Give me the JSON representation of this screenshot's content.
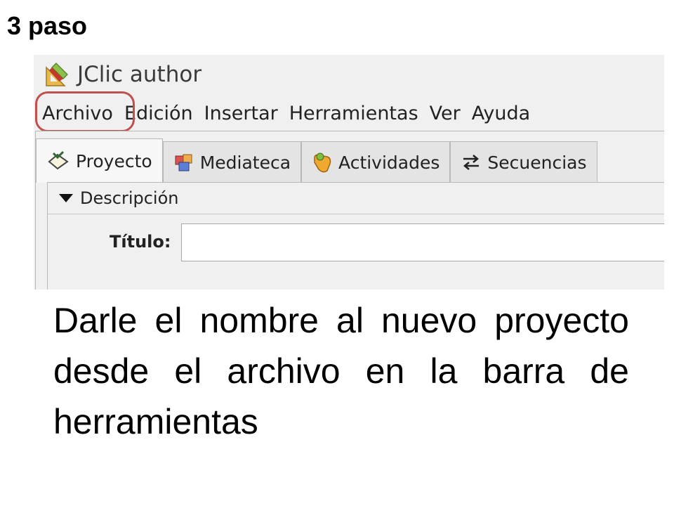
{
  "step": {
    "title": "3 paso"
  },
  "app": {
    "title": "JClic author",
    "icon": "jclic-pencil-icon"
  },
  "menu": {
    "items": [
      {
        "label": "Archivo",
        "highlighted": true
      },
      {
        "label": "Edición"
      },
      {
        "label": "Insertar"
      },
      {
        "label": "Herramientas"
      },
      {
        "label": "Ver"
      },
      {
        "label": "Ayuda"
      }
    ],
    "highlight_color": "#c0504d"
  },
  "tabs": [
    {
      "label": "Proyecto",
      "icon": "project-icon",
      "active": true
    },
    {
      "label": "Mediateca",
      "icon": "media-library-icon"
    },
    {
      "label": "Actividades",
      "icon": "activities-icon"
    },
    {
      "label": "Secuencias",
      "icon": "sequences-icon"
    }
  ],
  "project": {
    "section_label": "Descripción",
    "title_label": "Título:",
    "title_value": ""
  },
  "caption": {
    "text": "Darle el nombre al nuevo proyecto desde el archivo en la barra de herramientas"
  }
}
